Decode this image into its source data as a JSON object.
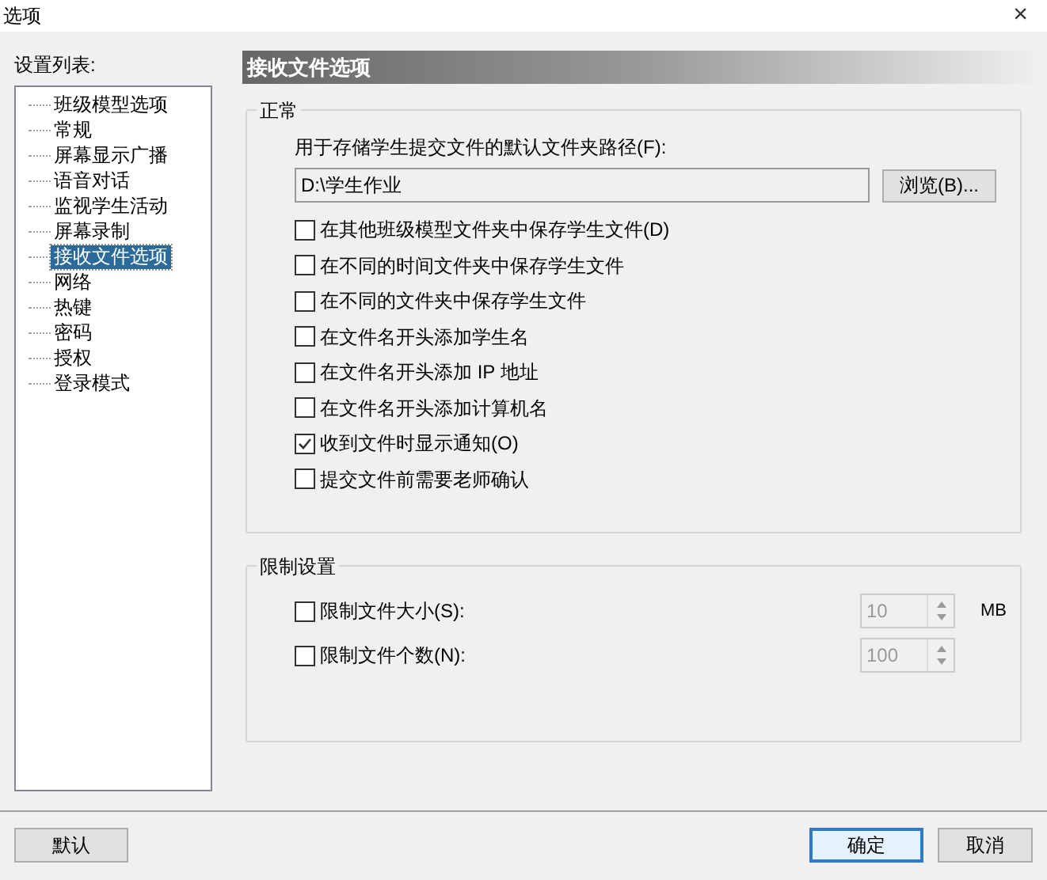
{
  "window": {
    "title": "选项",
    "close": "×"
  },
  "sidebar": {
    "label": "设置列表:",
    "items": [
      {
        "label": "班级模型选项",
        "selected": false
      },
      {
        "label": "常规",
        "selected": false
      },
      {
        "label": "屏幕显示广播",
        "selected": false
      },
      {
        "label": "语音对话",
        "selected": false
      },
      {
        "label": "监视学生活动",
        "selected": false
      },
      {
        "label": "屏幕录制",
        "selected": false
      },
      {
        "label": "接收文件选项",
        "selected": true
      },
      {
        "label": "网络",
        "selected": false
      },
      {
        "label": "热键",
        "selected": false
      },
      {
        "label": "密码",
        "selected": false
      },
      {
        "label": "授权",
        "selected": false
      },
      {
        "label": "登录模式",
        "selected": false
      }
    ]
  },
  "panel": {
    "title": "接收文件选项",
    "general": {
      "title": "正常",
      "path_label": "用于存储学生提交文件的默认文件夹路径(F):",
      "path_value": "D:\\学生作业",
      "browse": "浏览(B)...",
      "options": [
        {
          "label": "在其他班级模型文件夹中保存学生文件(D)",
          "checked": false
        },
        {
          "label": "在不同的时间文件夹中保存学生文件",
          "checked": false
        },
        {
          "label": "在不同的文件夹中保存学生文件",
          "checked": false
        },
        {
          "label": "在文件名开头添加学生名",
          "checked": false
        },
        {
          "label": "在文件名开头添加 IP 地址",
          "checked": false
        },
        {
          "label": "在文件名开头添加计算机名",
          "checked": false
        },
        {
          "label": "收到文件时显示通知(O)",
          "checked": true
        },
        {
          "label": "提交文件前需要老师确认",
          "checked": false
        }
      ]
    },
    "limits": {
      "title": "限制设置",
      "rows": [
        {
          "label": "限制文件大小(S):",
          "checked": false,
          "value": "10",
          "disabled": true,
          "unit": "MB"
        },
        {
          "label": "限制文件个数(N):",
          "checked": false,
          "value": "100",
          "disabled": true
        }
      ]
    }
  },
  "buttons": {
    "default": "默认",
    "ok": "确定",
    "cancel": "取消"
  }
}
